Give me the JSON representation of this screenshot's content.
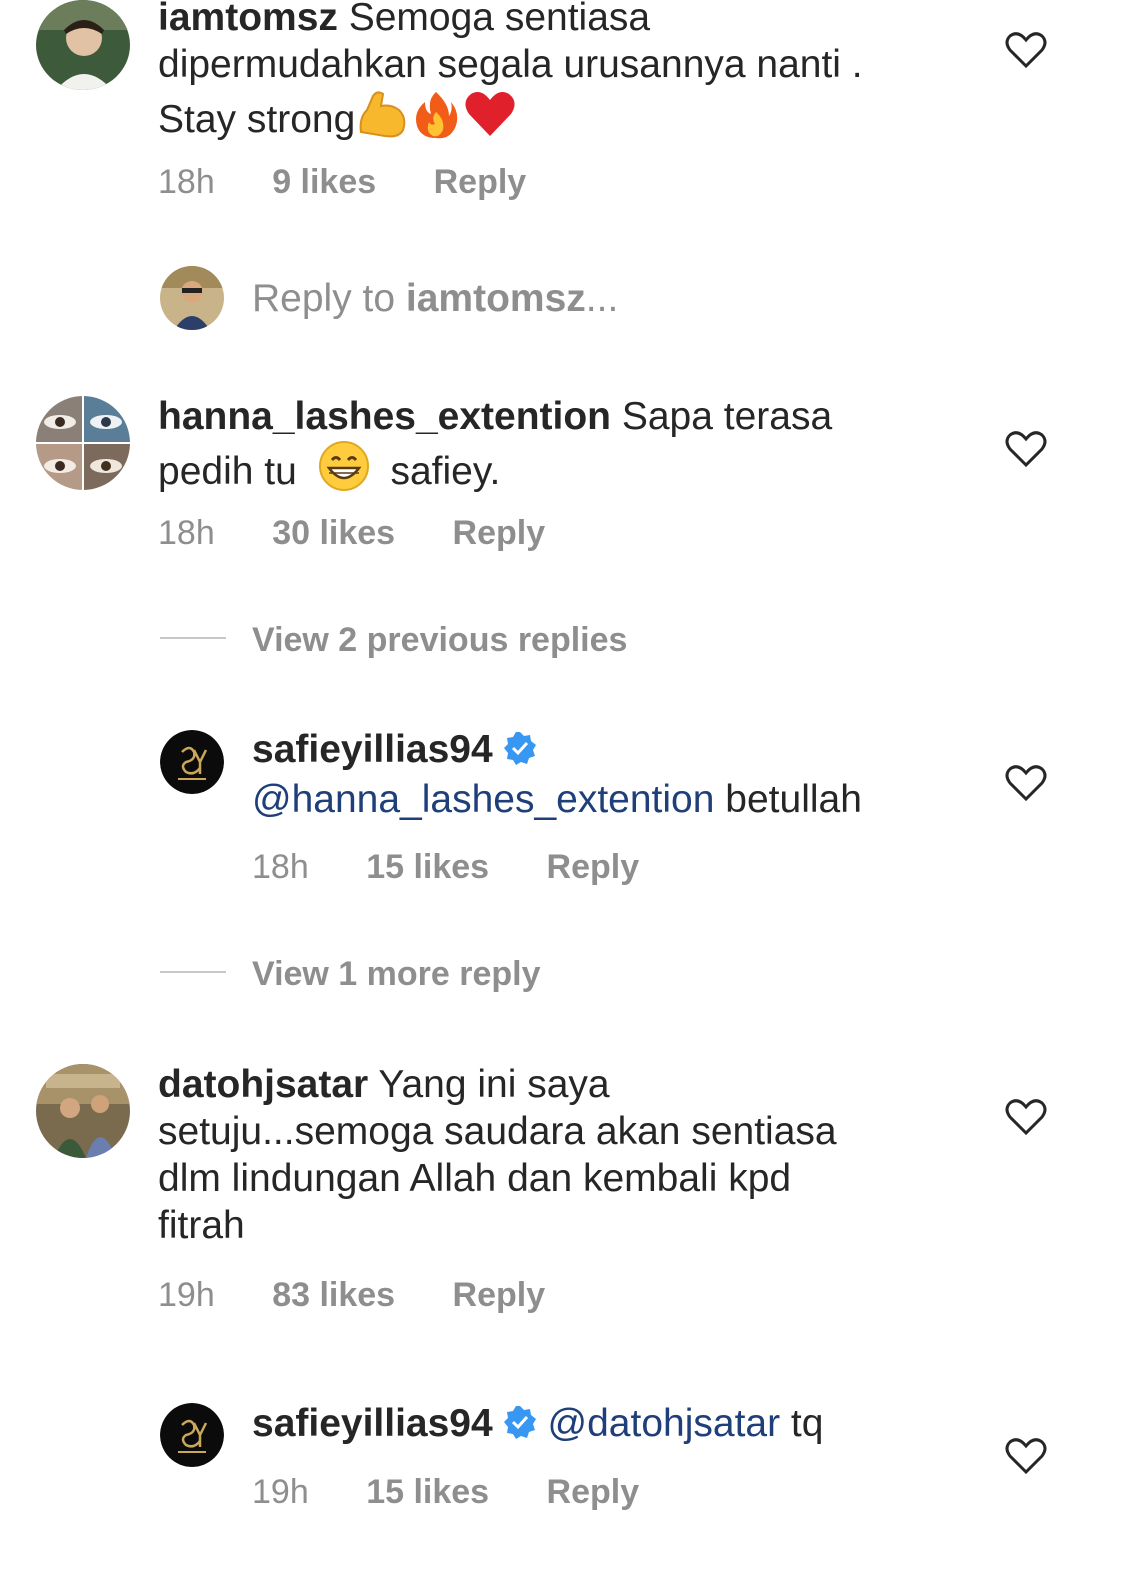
{
  "comments": [
    {
      "username": "iamtomsz",
      "text_line1": "Semoga sentiasa",
      "text_line2": "dipermudahkan segala urusannya nanti .",
      "text_line3": "Stay strong",
      "emojis": [
        "flexed-biceps",
        "fire",
        "red-heart"
      ],
      "time": "18h",
      "likes": "9 likes",
      "reply": "Reply"
    },
    {
      "username": "hanna_lashes_extention",
      "text_line1": "Sapa terasa",
      "text_line2_a": "pedih tu",
      "text_line2_b": "safiey.",
      "emoji": "grinning-face",
      "time": "18h",
      "likes": "30 likes",
      "reply": "Reply"
    },
    {
      "username": "datohjsatar",
      "text_line1": "Yang ini saya",
      "text_line2": "setuju...semoga saudara akan sentiasa",
      "text_line3": "dlm lindungan Allah dan kembali kpd",
      "text_line4": "fitrah",
      "time": "19h",
      "likes": "83 likes",
      "reply": "Reply"
    }
  ],
  "reply_composer": {
    "prefix": "Reply to ",
    "target": "iamtomsz",
    "suffix": "..."
  },
  "thread_controls": {
    "view_previous": "View 2 previous replies",
    "view_more": "View 1 more reply"
  },
  "replies": [
    {
      "username": "safieyillias94",
      "verified": true,
      "mention": "@hanna_lashes_extention",
      "text": " betullah",
      "time": "18h",
      "likes": "15 likes",
      "reply": "Reply"
    },
    {
      "username": "safieyillias94",
      "verified": true,
      "mention": "@datohjsatar",
      "text": " tq",
      "time": "19h",
      "likes": "15 likes",
      "reply": "Reply"
    }
  ],
  "colors": {
    "text": "#262626",
    "secondary": "#8e8e8e",
    "mention": "#1f3f7a",
    "verified": "#3897f0"
  }
}
